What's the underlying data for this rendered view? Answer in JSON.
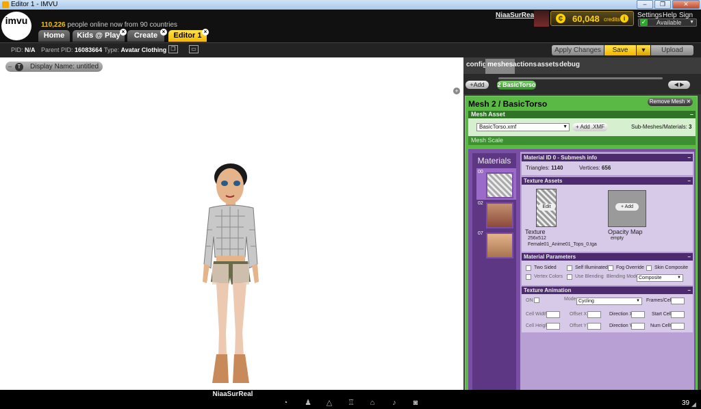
{
  "window": {
    "title": "Editor 1 - IMVU",
    "min": "–",
    "restore": "❐",
    "close": "✕"
  },
  "header": {
    "logo": "imvu",
    "online_count": "110,226",
    "online_text": "people online now from 90 countries",
    "username": "NiaaSurReal",
    "credits": "60,048",
    "credits_label": "credits",
    "settings": "Settings",
    "help": "Help",
    "sign_out": "Sign Out",
    "status": "Available"
  },
  "tabs": [
    "Home",
    "Kids @ Play",
    "Create",
    "Editor 1"
  ],
  "meta": {
    "pid_label": "PID:",
    "pid": "N/A",
    "parent_label": "Parent PID:",
    "parent_pid": "16083664",
    "type_label": "Type:",
    "type": "Avatar Clothing"
  },
  "toolbar": {
    "apply": "Apply Changes",
    "save": "Save",
    "upload": "Upload"
  },
  "viewport": {
    "display_name_label": "Display Name:",
    "display_name": "untitled",
    "avatar_name": "NiaaSurReal"
  },
  "panel": {
    "tabs": [
      "config",
      "meshes",
      "actions",
      "assets",
      "debug"
    ],
    "active_tab": "meshes",
    "add_label": "Add",
    "mesh_chip": "2 BasicTorso",
    "mesh_title": "Mesh 2 / BasicTorso",
    "remove_mesh": "Remove Mesh",
    "mesh_asset": {
      "header": "Mesh Asset",
      "file": "BasicTorso.xmf",
      "add_xmf": "Add .XMF",
      "submeshes_label": "Sub-Meshes/Materials:",
      "submeshes": "3"
    },
    "mesh_scale": "Mesh Scale",
    "materials": {
      "label": "Materials",
      "ids": [
        "00",
        "02",
        "07"
      ]
    },
    "material_info": {
      "header": "Material ID 0 - Submesh info",
      "triangles_label": "Triangles:",
      "triangles": "1140",
      "vertices_label": "Vertices:",
      "vertices": "656"
    },
    "texture_assets": {
      "header": "Texture Assets",
      "texture_label": "Texture",
      "edit": "Edit",
      "texture_size": "256x512",
      "texture_file": "Female01_Anime01_Tops_0.tga",
      "opacity_label": "Opacity Map",
      "opacity_add": "Add",
      "opacity_state": "empty"
    },
    "material_params": {
      "header": "Material Parameters",
      "two_sided": "Two Sided",
      "self_illuminated": "Self Illuminated",
      "fog_override": "Fog Override",
      "skin_composite": "Skin Composite",
      "vertex_colors": "Vertex Colors",
      "use_blending": "Use Blending",
      "blending_mode_label": "Blending Mode",
      "blending_mode": "Composite"
    },
    "texture_animation": {
      "header": "Texture Animation",
      "on": "ON",
      "mode_label": "Mode",
      "mode": "Cycling",
      "frames_cell": "Frames/Cell",
      "cell_width": "Cell Width",
      "offset_x": "Offset X",
      "direction_x": "Direction X",
      "start_cell": "Start Cell",
      "cell_height": "Cell Height",
      "offset_y": "Offset Y",
      "direction_y": "Direction Y",
      "num_cells": "Num Cells"
    }
  },
  "bottom": {
    "icons": [
      "chat-icon",
      "shirt-icon",
      "hanger-icon",
      "chair-icon",
      "home-icon",
      "music-icon",
      "camera-icon"
    ],
    "count": "39"
  }
}
